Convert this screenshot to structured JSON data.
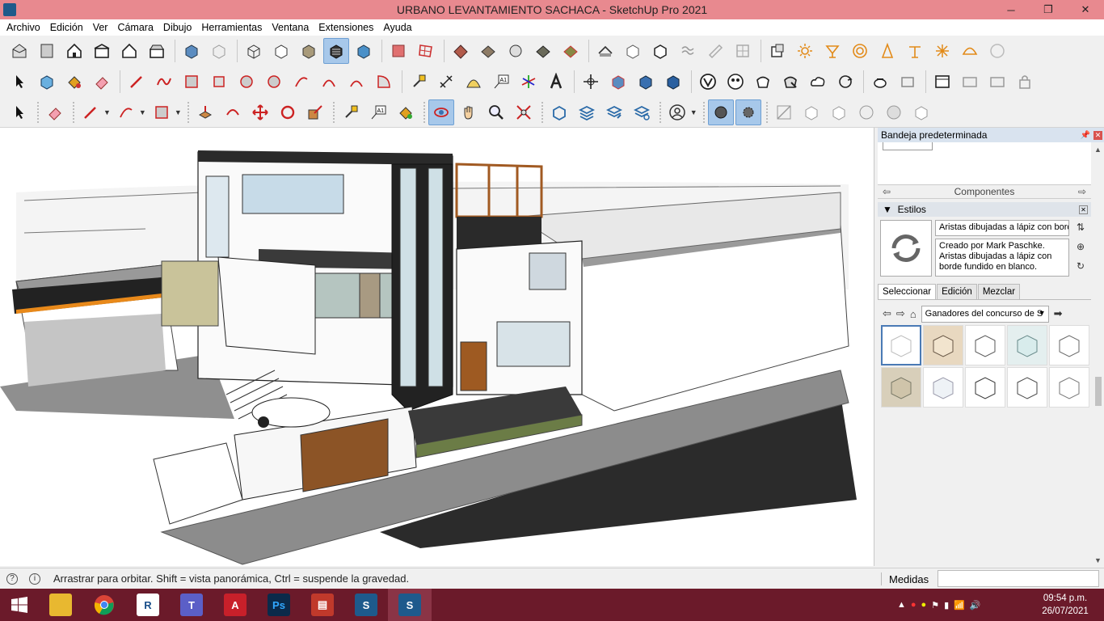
{
  "window": {
    "title": "URBANO LEVANTAMIENTO SACHACA - SketchUp Pro 2021",
    "minimize": "─",
    "maximize": "❐",
    "close": "✕"
  },
  "menu": [
    "Archivo",
    "Edición",
    "Ver",
    "Cámara",
    "Dibujo",
    "Herramientas",
    "Ventana",
    "Extensiones",
    "Ayuda"
  ],
  "tray": {
    "title": "Bandeja predeterminada",
    "components_label": "Componentes",
    "styles_header": "Estilos",
    "style_name": "Aristas dibujadas a lápiz con borde",
    "style_description": "Creado por Mark Paschke. Aristas dibujadas a lápiz con borde fundido en blanco.",
    "tabs": [
      "Seleccionar",
      "Edición",
      "Mezclar"
    ],
    "collection": "Ganadores del concurso de S"
  },
  "status": {
    "message": "Arrastrar para orbitar. Shift = vista panorámica, Ctrl = suspende la gravedad.",
    "measure_label": "Medidas",
    "measure_value": ""
  },
  "taskbar": {
    "time": "09:54 p.m.",
    "date": "26/07/2021"
  },
  "colors": {
    "titlebar": "#e8898f",
    "taskbar": "#6b1a2a",
    "active_tool": "#a7c8ea"
  }
}
